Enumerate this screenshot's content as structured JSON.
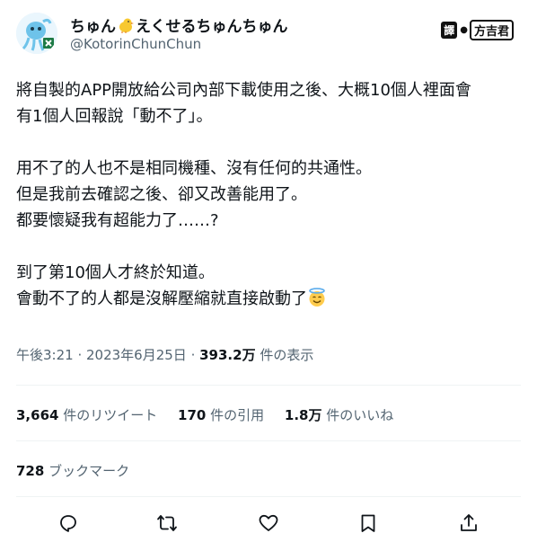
{
  "author": {
    "display_name": "ちゅん🐤えくせるちゅんちゅん",
    "display_name_text": "ちゅん",
    "display_name_text2": "えくせるちゅんちゅん",
    "handle": "@KotorinChunChun",
    "avatar_icon": "bird-avatar"
  },
  "translator": {
    "tag": "譯",
    "name": "方吉君"
  },
  "tweet": {
    "paragraphs": [
      [
        "將自製的APP開放給公司內部下載使用之後、大概10個人裡面會",
        "有1個人回報說「動不了」。"
      ],
      [
        "用不了的人也不是相同機種、沒有任何的共通性。",
        "但是我前去確認之後、卻又改善能用了。",
        "都要懷疑我有超能力了……?"
      ],
      [
        "到了第10個人才終於知道。",
        "會動不了的人都是沒解壓縮就直接啟動了"
      ]
    ],
    "trailing_emoji": "smiling-face-with-halo"
  },
  "meta": {
    "time": "午後3:21",
    "separator": " · ",
    "date": "2023年6月25日",
    "views": "393.2万",
    "views_label": " 件の表示"
  },
  "stats": {
    "retweets": "3,664",
    "retweets_label": " 件のリツイート",
    "quotes": "170",
    "quotes_label": " 件の引用",
    "likes": "1.8万",
    "likes_label": " 件のいいね",
    "bookmarks": "728",
    "bookmarks_label": " ブックマーク"
  },
  "actions": [
    "reply-icon",
    "retweet-icon",
    "like-icon",
    "bookmark-icon",
    "share-icon"
  ],
  "colors": {
    "text": "#0f1419",
    "secondary": "#536471",
    "divider": "#eff3f4"
  }
}
